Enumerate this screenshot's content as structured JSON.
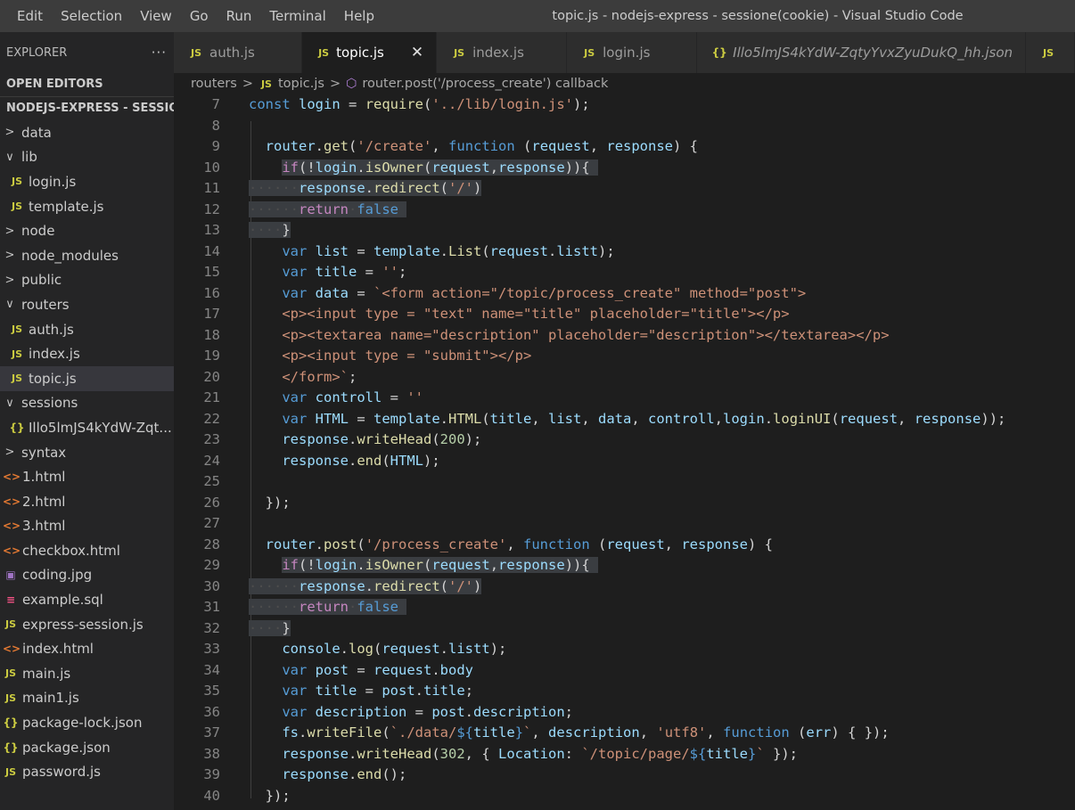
{
  "menu": [
    "Edit",
    "Selection",
    "View",
    "Go",
    "Run",
    "Terminal",
    "Help"
  ],
  "window_title": "topic.js - nodejs-express - sessione(cookie) - Visual Studio Code",
  "explorer": {
    "title": "EXPLORER",
    "more": "···",
    "open_editors": "OPEN EDITORS",
    "project": "NODEJS-EXPRESS - SESSIO...",
    "tree": [
      {
        "label": "data",
        "type": "folder",
        "state": "collapsed",
        "depth": 0
      },
      {
        "label": "lib",
        "type": "folder",
        "state": "expanded",
        "depth": 0
      },
      {
        "label": "login.js",
        "type": "js",
        "depth": 1
      },
      {
        "label": "template.js",
        "type": "js",
        "depth": 1
      },
      {
        "label": "node",
        "type": "folder",
        "state": "collapsed",
        "depth": 0
      },
      {
        "label": "node_modules",
        "type": "folder",
        "state": "collapsed",
        "depth": 0
      },
      {
        "label": "public",
        "type": "folder",
        "state": "collapsed",
        "depth": 0
      },
      {
        "label": "routers",
        "type": "folder",
        "state": "expanded",
        "depth": 0
      },
      {
        "label": "auth.js",
        "type": "js",
        "depth": 1
      },
      {
        "label": "index.js",
        "type": "js",
        "depth": 1
      },
      {
        "label": "topic.js",
        "type": "js",
        "depth": 1,
        "active": true
      },
      {
        "label": "sessions",
        "type": "folder",
        "state": "expanded",
        "depth": 0
      },
      {
        "label": "Illo5lmJS4kYdW-Zqt...",
        "type": "json",
        "depth": 1
      },
      {
        "label": "syntax",
        "type": "folder",
        "state": "collapsed",
        "depth": 0
      },
      {
        "label": "1.html",
        "type": "html",
        "depth": 0
      },
      {
        "label": "2.html",
        "type": "html",
        "depth": 0
      },
      {
        "label": "3.html",
        "type": "html",
        "depth": 0
      },
      {
        "label": "checkbox.html",
        "type": "html",
        "depth": 0
      },
      {
        "label": "coding.jpg",
        "type": "img",
        "depth": 0
      },
      {
        "label": "example.sql",
        "type": "db",
        "depth": 0
      },
      {
        "label": "express-session.js",
        "type": "js",
        "depth": 0
      },
      {
        "label": "index.html",
        "type": "html",
        "depth": 0
      },
      {
        "label": "main.js",
        "type": "js",
        "depth": 0
      },
      {
        "label": "main1.js",
        "type": "js",
        "depth": 0
      },
      {
        "label": "package-lock.json",
        "type": "json",
        "depth": 0
      },
      {
        "label": "package.json",
        "type": "json",
        "depth": 0
      },
      {
        "label": "password.js",
        "type": "js",
        "depth": 0
      }
    ]
  },
  "tabs": [
    {
      "label": "auth.js",
      "icon": "JS",
      "active": false
    },
    {
      "label": "topic.js",
      "icon": "JS",
      "active": true,
      "close": "✕"
    },
    {
      "label": "index.js",
      "icon": "JS",
      "active": false
    },
    {
      "label": "login.js",
      "icon": "JS",
      "active": false
    },
    {
      "label": "Illo5lmJS4kYdW-ZqtyYvxZyuDukQ_hh.json",
      "icon": "{}",
      "active": false,
      "italic": true
    },
    {
      "label": "",
      "icon": "JS",
      "active": false
    }
  ],
  "breadcrumb": {
    "folder": "routers",
    "file": "topic.js",
    "symbol": "router.post('/process_create') callback"
  },
  "code_lines": [
    {
      "n": "7",
      "t": [
        [
          "kw",
          "const"
        ],
        [
          "pl",
          " "
        ],
        [
          "var",
          "login"
        ],
        [
          "pl",
          " = "
        ],
        [
          "fn",
          "require"
        ],
        [
          "pl",
          "("
        ],
        [
          "str",
          "'../lib/login.js'"
        ],
        [
          "pl",
          ");"
        ]
      ]
    },
    {
      "n": "8",
      "t": []
    },
    {
      "n": "9",
      "t": [
        [
          "pl",
          "  "
        ],
        [
          "var",
          "router"
        ],
        [
          "pl",
          "."
        ],
        [
          "fn",
          "get"
        ],
        [
          "pl",
          "("
        ],
        [
          "str",
          "'/create'"
        ],
        [
          "pl",
          ", "
        ],
        [
          "kw",
          "function"
        ],
        [
          "pl",
          " ("
        ],
        [
          "var",
          "request"
        ],
        [
          "pl",
          ", "
        ],
        [
          "var",
          "response"
        ],
        [
          "pl",
          ") {"
        ]
      ]
    },
    {
      "n": "10",
      "hl": true,
      "t": [
        [
          "pl",
          "    "
        ],
        [
          "ctl",
          "if"
        ],
        [
          "pl",
          "(!"
        ],
        [
          "var",
          "login"
        ],
        [
          "pl",
          "."
        ],
        [
          "fn",
          "isOwner"
        ],
        [
          "pl",
          "("
        ],
        [
          "var",
          "request"
        ],
        [
          "pl",
          ","
        ],
        [
          "var",
          "response"
        ],
        [
          "pl",
          ")){ "
        ]
      ]
    },
    {
      "n": "11",
      "hl": true,
      "t": [
        [
          "ws",
          "······"
        ],
        [
          "var",
          "response"
        ],
        [
          "pl",
          "."
        ],
        [
          "fn",
          "redirect"
        ],
        [
          "pl",
          "("
        ],
        [
          "str",
          "'/'"
        ],
        [
          "pl",
          ")"
        ]
      ]
    },
    {
      "n": "12",
      "hl": true,
      "t": [
        [
          "ws",
          "······"
        ],
        [
          "ctl",
          "return"
        ],
        [
          "ws",
          "·"
        ],
        [
          "kw",
          "false"
        ],
        [
          "pl",
          " "
        ]
      ]
    },
    {
      "n": "13",
      "hl": true,
      "t": [
        [
          "ws",
          "····"
        ],
        [
          "pl",
          "}"
        ]
      ]
    },
    {
      "n": "14",
      "t": [
        [
          "pl",
          "    "
        ],
        [
          "kw",
          "var"
        ],
        [
          "pl",
          " "
        ],
        [
          "var",
          "list"
        ],
        [
          "pl",
          " = "
        ],
        [
          "var",
          "template"
        ],
        [
          "pl",
          "."
        ],
        [
          "fn",
          "List"
        ],
        [
          "pl",
          "("
        ],
        [
          "var",
          "request"
        ],
        [
          "pl",
          "."
        ],
        [
          "var",
          "listt"
        ],
        [
          "pl",
          ");"
        ]
      ]
    },
    {
      "n": "15",
      "t": [
        [
          "pl",
          "    "
        ],
        [
          "kw",
          "var"
        ],
        [
          "pl",
          " "
        ],
        [
          "var",
          "title"
        ],
        [
          "pl",
          " = "
        ],
        [
          "str",
          "''"
        ],
        [
          "pl",
          ";"
        ]
      ]
    },
    {
      "n": "16",
      "t": [
        [
          "pl",
          "    "
        ],
        [
          "kw",
          "var"
        ],
        [
          "pl",
          " "
        ],
        [
          "var",
          "data"
        ],
        [
          "pl",
          " = "
        ],
        [
          "str",
          "`<form action=\"/topic/process_create\" method=\"post\">"
        ]
      ]
    },
    {
      "n": "17",
      "t": [
        [
          "str",
          "    <p><input type = \"text\" name=\"title\" placeholder=\"title\"></p>"
        ]
      ]
    },
    {
      "n": "18",
      "t": [
        [
          "str",
          "    <p><textarea name=\"description\" placeholder=\"description\"></textarea></p>"
        ]
      ]
    },
    {
      "n": "19",
      "t": [
        [
          "str",
          "    <p><input type = \"submit\"></p>"
        ]
      ]
    },
    {
      "n": "20",
      "t": [
        [
          "str",
          "    </form>`"
        ],
        [
          "pl",
          ";"
        ]
      ]
    },
    {
      "n": "21",
      "t": [
        [
          "pl",
          "    "
        ],
        [
          "kw",
          "var"
        ],
        [
          "pl",
          " "
        ],
        [
          "var",
          "controll"
        ],
        [
          "pl",
          " = "
        ],
        [
          "str",
          "''"
        ]
      ]
    },
    {
      "n": "22",
      "t": [
        [
          "pl",
          "    "
        ],
        [
          "kw",
          "var"
        ],
        [
          "pl",
          " "
        ],
        [
          "var",
          "HTML"
        ],
        [
          "pl",
          " = "
        ],
        [
          "var",
          "template"
        ],
        [
          "pl",
          "."
        ],
        [
          "fn",
          "HTML"
        ],
        [
          "pl",
          "("
        ],
        [
          "var",
          "title"
        ],
        [
          "pl",
          ", "
        ],
        [
          "var",
          "list"
        ],
        [
          "pl",
          ", "
        ],
        [
          "var",
          "data"
        ],
        [
          "pl",
          ", "
        ],
        [
          "var",
          "controll"
        ],
        [
          "pl",
          ","
        ],
        [
          "var",
          "login"
        ],
        [
          "pl",
          "."
        ],
        [
          "fn",
          "loginUI"
        ],
        [
          "pl",
          "("
        ],
        [
          "var",
          "request"
        ],
        [
          "pl",
          ", "
        ],
        [
          "var",
          "response"
        ],
        [
          "pl",
          "));"
        ]
      ]
    },
    {
      "n": "23",
      "t": [
        [
          "pl",
          "    "
        ],
        [
          "var",
          "response"
        ],
        [
          "pl",
          "."
        ],
        [
          "fn",
          "writeHead"
        ],
        [
          "pl",
          "("
        ],
        [
          "num",
          "200"
        ],
        [
          "pl",
          ");"
        ]
      ]
    },
    {
      "n": "24",
      "t": [
        [
          "pl",
          "    "
        ],
        [
          "var",
          "response"
        ],
        [
          "pl",
          "."
        ],
        [
          "fn",
          "end"
        ],
        [
          "pl",
          "("
        ],
        [
          "var",
          "HTML"
        ],
        [
          "pl",
          ");"
        ]
      ]
    },
    {
      "n": "25",
      "t": []
    },
    {
      "n": "26",
      "t": [
        [
          "pl",
          "  });"
        ]
      ]
    },
    {
      "n": "27",
      "t": []
    },
    {
      "n": "28",
      "t": [
        [
          "pl",
          "  "
        ],
        [
          "var",
          "router"
        ],
        [
          "pl",
          "."
        ],
        [
          "fn",
          "post"
        ],
        [
          "pl",
          "("
        ],
        [
          "str",
          "'/process_create'"
        ],
        [
          "pl",
          ", "
        ],
        [
          "kw",
          "function"
        ],
        [
          "pl",
          " ("
        ],
        [
          "var",
          "request"
        ],
        [
          "pl",
          ", "
        ],
        [
          "var",
          "response"
        ],
        [
          "pl",
          ") {"
        ]
      ]
    },
    {
      "n": "29",
      "hl": true,
      "t": [
        [
          "pl",
          "    "
        ],
        [
          "ctl",
          "if"
        ],
        [
          "pl",
          "(!"
        ],
        [
          "var",
          "login"
        ],
        [
          "pl",
          "."
        ],
        [
          "fn",
          "isOwner"
        ],
        [
          "pl",
          "("
        ],
        [
          "var",
          "request"
        ],
        [
          "pl",
          ","
        ],
        [
          "var",
          "response"
        ],
        [
          "pl",
          ")){ "
        ]
      ]
    },
    {
      "n": "30",
      "hl": true,
      "t": [
        [
          "ws",
          "······"
        ],
        [
          "var",
          "response"
        ],
        [
          "pl",
          "."
        ],
        [
          "fn",
          "redirect"
        ],
        [
          "pl",
          "("
        ],
        [
          "str",
          "'/'"
        ],
        [
          "pl",
          ")"
        ]
      ]
    },
    {
      "n": "31",
      "hl": true,
      "t": [
        [
          "ws",
          "······"
        ],
        [
          "ctl",
          "return"
        ],
        [
          "ws",
          "·"
        ],
        [
          "kw",
          "false"
        ],
        [
          "pl",
          " "
        ]
      ]
    },
    {
      "n": "32",
      "hl": true,
      "t": [
        [
          "ws",
          "····"
        ],
        [
          "pl",
          "}"
        ]
      ]
    },
    {
      "n": "33",
      "t": [
        [
          "pl",
          "    "
        ],
        [
          "var",
          "console"
        ],
        [
          "pl",
          "."
        ],
        [
          "fn",
          "log"
        ],
        [
          "pl",
          "("
        ],
        [
          "var",
          "request"
        ],
        [
          "pl",
          "."
        ],
        [
          "var",
          "listt"
        ],
        [
          "pl",
          ");"
        ]
      ]
    },
    {
      "n": "34",
      "t": [
        [
          "pl",
          "    "
        ],
        [
          "kw",
          "var"
        ],
        [
          "pl",
          " "
        ],
        [
          "var",
          "post"
        ],
        [
          "pl",
          " = "
        ],
        [
          "var",
          "request"
        ],
        [
          "pl",
          "."
        ],
        [
          "var",
          "body"
        ]
      ]
    },
    {
      "n": "35",
      "t": [
        [
          "pl",
          "    "
        ],
        [
          "kw",
          "var"
        ],
        [
          "pl",
          " "
        ],
        [
          "var",
          "title"
        ],
        [
          "pl",
          " = "
        ],
        [
          "var",
          "post"
        ],
        [
          "pl",
          "."
        ],
        [
          "var",
          "title"
        ],
        [
          "pl",
          ";"
        ]
      ]
    },
    {
      "n": "36",
      "t": [
        [
          "pl",
          "    "
        ],
        [
          "kw",
          "var"
        ],
        [
          "pl",
          " "
        ],
        [
          "var",
          "description"
        ],
        [
          "pl",
          " = "
        ],
        [
          "var",
          "post"
        ],
        [
          "pl",
          "."
        ],
        [
          "var",
          "description"
        ],
        [
          "pl",
          ";"
        ]
      ]
    },
    {
      "n": "37",
      "t": [
        [
          "pl",
          "    "
        ],
        [
          "var",
          "fs"
        ],
        [
          "pl",
          "."
        ],
        [
          "fn",
          "writeFile"
        ],
        [
          "pl",
          "("
        ],
        [
          "str",
          "`./data/"
        ],
        [
          "kw",
          "${"
        ],
        [
          "var",
          "title"
        ],
        [
          "kw",
          "}"
        ],
        [
          "str",
          "`"
        ],
        [
          "pl",
          ", "
        ],
        [
          "var",
          "description"
        ],
        [
          "pl",
          ", "
        ],
        [
          "str",
          "'utf8'"
        ],
        [
          "pl",
          ", "
        ],
        [
          "kw",
          "function"
        ],
        [
          "pl",
          " ("
        ],
        [
          "var",
          "err"
        ],
        [
          "pl",
          ") { });"
        ]
      ]
    },
    {
      "n": "38",
      "t": [
        [
          "pl",
          "    "
        ],
        [
          "var",
          "response"
        ],
        [
          "pl",
          "."
        ],
        [
          "fn",
          "writeHead"
        ],
        [
          "pl",
          "("
        ],
        [
          "num",
          "302"
        ],
        [
          "pl",
          ", { "
        ],
        [
          "var",
          "Location"
        ],
        [
          "pl",
          ": "
        ],
        [
          "str",
          "`/topic/page/"
        ],
        [
          "kw",
          "${"
        ],
        [
          "var",
          "title"
        ],
        [
          "kw",
          "}"
        ],
        [
          "str",
          "`"
        ],
        [
          "pl",
          " });"
        ]
      ]
    },
    {
      "n": "39",
      "t": [
        [
          "pl",
          "    "
        ],
        [
          "var",
          "response"
        ],
        [
          "pl",
          "."
        ],
        [
          "fn",
          "end"
        ],
        [
          "pl",
          "();"
        ]
      ]
    },
    {
      "n": "40",
      "t": [
        [
          "pl",
          "  });"
        ]
      ]
    }
  ],
  "colors": {
    "keyword": "#569cd6",
    "control": "#c586c0",
    "string": "#ce9178",
    "function": "#dcdcaa",
    "variable": "#9cdcfe",
    "number": "#b5cea8"
  }
}
